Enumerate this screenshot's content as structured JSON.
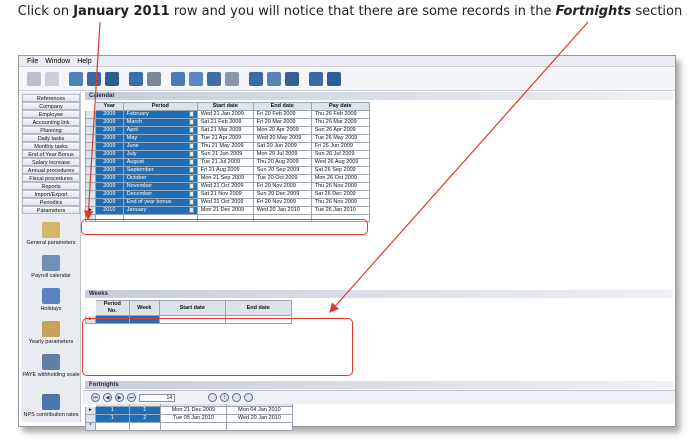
{
  "caption": {
    "part1": "Click on ",
    "bold1": "January 2011",
    "part2": " row and you will notice that there are some records in the ",
    "bold2": "Fortnights",
    "part3": " section"
  },
  "menu": [
    "File",
    "Window",
    "Help"
  ],
  "nav": {
    "buttons": [
      "References",
      "Company",
      "Employee",
      "Accounting link",
      "Planning",
      "Daily tasks",
      "Monthly tasks",
      "End of Year Bonus",
      "Salary increase",
      "Annual procedures",
      "Fiscal procedures",
      "Reports",
      "Import/Export",
      "Periodics",
      "Parameters"
    ],
    "icons": [
      "General parameters",
      "Payroll calendar",
      "Holidays",
      "Yearly parameters",
      "PAYE withholding scale",
      "NPS contribution rates"
    ]
  },
  "calendar": {
    "title": "Calendar",
    "headers": [
      "Year",
      "Period",
      "Start date",
      "End date",
      "Pay date"
    ],
    "rows": [
      [
        "2009",
        "February",
        "Wed 21 Jan 2009",
        "Fri 20 Feb 2009",
        "Thu 26 Feb 2009"
      ],
      [
        "2009",
        "March",
        "Sat 21 Feb 2009",
        "Fri 20 Mar 2009",
        "Thu 26 Mar 2009"
      ],
      [
        "2009",
        "April",
        "Sat 21 Mar 2009",
        "Mon 20 Apr 2009",
        "Sun 26 Apr 2009"
      ],
      [
        "2009",
        "May",
        "Tue 21 Apr 2009",
        "Wed 20 May 2009",
        "Tue 26 May 2009"
      ],
      [
        "2009",
        "June",
        "Thu 21 May 2009",
        "Sat 20 Jun 2009",
        "Fri 26 Jun 2009"
      ],
      [
        "2009",
        "July",
        "Sun 21 Jun 2009",
        "Mon 20 Jul 2009",
        "Sun 26 Jul 2009"
      ],
      [
        "2009",
        "August",
        "Tue 21 Jul 2009",
        "Thu 20 Aug 2009",
        "Wed 26 Aug 2009"
      ],
      [
        "2009",
        "September",
        "Fri 21 Aug 2009",
        "Sun 20 Sep 2009",
        "Sat 26 Sep 2009"
      ],
      [
        "2009",
        "October",
        "Mon 21 Sep 2009",
        "Tue 20 Oct 2009",
        "Mon 26 Oct 2009"
      ],
      [
        "2009",
        "November",
        "Wed 21 Oct 2009",
        "Fri 20 Nov 2009",
        "Thu 26 Nov 2009"
      ],
      [
        "2009",
        "December",
        "Sat 21 Nov 2009",
        "Sun 20 Dec 2009",
        "Sat 26 Dec 2009"
      ],
      [
        "2009",
        "End of year bonus",
        "Wed 21 Oct 2009",
        "Fri 20 Nov 2009",
        "Thu 26 Nov 2009"
      ],
      [
        "2010",
        "January",
        "Mon 21 Dec 2009",
        "Wed 20 Jan 2010",
        "Tue 26 Jan 2010"
      ]
    ]
  },
  "weeks": {
    "title": "Weeks",
    "headers": [
      "Period No.",
      "Week",
      "Start date",
      "End date"
    ]
  },
  "fortnights": {
    "title": "Fortnights",
    "headers": [
      "Period No.",
      "Fortnight",
      "Start date",
      "End date"
    ],
    "rows": [
      [
        "1",
        "1",
        "Mon 21 Dec 2009",
        "Mon 04 Jan 2010"
      ],
      [
        "1",
        "2",
        "Tue 05 Jan 2010",
        "Wed 20 Jan 2010"
      ]
    ]
  },
  "status": {
    "record": "14"
  },
  "colors": {
    "highlight": "#e0392b",
    "selection": "#1c6fb8"
  }
}
